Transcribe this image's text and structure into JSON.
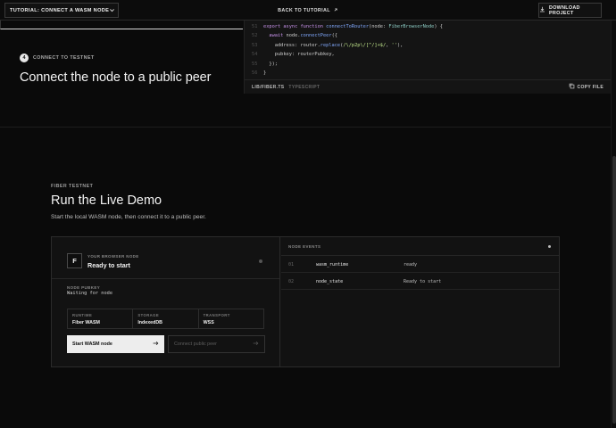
{
  "nav": {
    "tutorial_select": "TUTORIAL: CONNECT A WASM NODE",
    "back_link": "BACK TO TUTORIAL",
    "download_button": "DOWNLOAD PROJECT"
  },
  "step": {
    "number": "4",
    "label": "CONNECT TO TESTNET",
    "title": "Connect the node to a public peer"
  },
  "code": {
    "lines": [
      {
        "n": "51",
        "tokens": [
          [
            "kw",
            "export async function "
          ],
          [
            "fn",
            "connectToRouter"
          ],
          [
            "tx",
            "(node: "
          ],
          [
            "ty",
            "FiberBrowserNode"
          ],
          [
            "tx",
            ") {"
          ]
        ]
      },
      {
        "n": "52",
        "tokens": [
          [
            "tx",
            "  "
          ],
          [
            "kw",
            "await "
          ],
          [
            "tx",
            "node."
          ],
          [
            "fn",
            "connectPeer"
          ],
          [
            "tx",
            "({"
          ]
        ]
      },
      {
        "n": "53",
        "tokens": [
          [
            "tx",
            "    address: router."
          ],
          [
            "fn",
            "replace"
          ],
          [
            "tx",
            "("
          ],
          [
            "st",
            "/\\/p2p\\/[^/]+$/"
          ],
          [
            "tx",
            ", "
          ],
          [
            "st",
            "''"
          ],
          [
            "tx",
            "),"
          ]
        ]
      },
      {
        "n": "54",
        "tokens": [
          [
            "tx",
            "    pubkey: routerPubkey,"
          ]
        ]
      },
      {
        "n": "55",
        "tokens": [
          [
            "tx",
            "  });"
          ]
        ]
      },
      {
        "n": "56",
        "tokens": [
          [
            "tx",
            "}"
          ]
        ]
      }
    ],
    "file_name": "LIB/FIBER.TS",
    "language": "TYPESCRIPT",
    "copy_label": "COPY FILE"
  },
  "demo": {
    "eyebrow": "FIBER TESTNET",
    "title": "Run the Live Demo",
    "subtitle": "Start the local WASM node, then connect it to a public peer.",
    "node": {
      "avatar": "F",
      "caption": "YOUR BROWSER NODE",
      "status": "Ready to start",
      "pubkey_label": "NODE PUBKEY",
      "pubkey_value": "Waiting for node"
    },
    "stats": [
      {
        "label": "RUNTIME",
        "value": "Fiber WASM"
      },
      {
        "label": "STORAGE",
        "value": "IndexedDB"
      },
      {
        "label": "TRANSPORT",
        "value": "WSS"
      }
    ],
    "start_button": "Start WASM node",
    "connect_button": "Connect public peer",
    "events": {
      "title": "NODE EVENTS",
      "rows": [
        {
          "index": "01",
          "key": "wasm_runtime",
          "value": "ready"
        },
        {
          "index": "02",
          "key": "node_state",
          "value": "Ready to start"
        }
      ]
    }
  },
  "icons": {
    "chevron": "chevron-down-icon",
    "arrow_up_right": "arrow-up-right-icon",
    "download": "download-icon",
    "copy": "copy-icon",
    "arrow_right": "arrow-right-icon"
  },
  "colors": {
    "background": "#0a0a0a",
    "panel": "#121212",
    "primary_button": "#ededed"
  }
}
